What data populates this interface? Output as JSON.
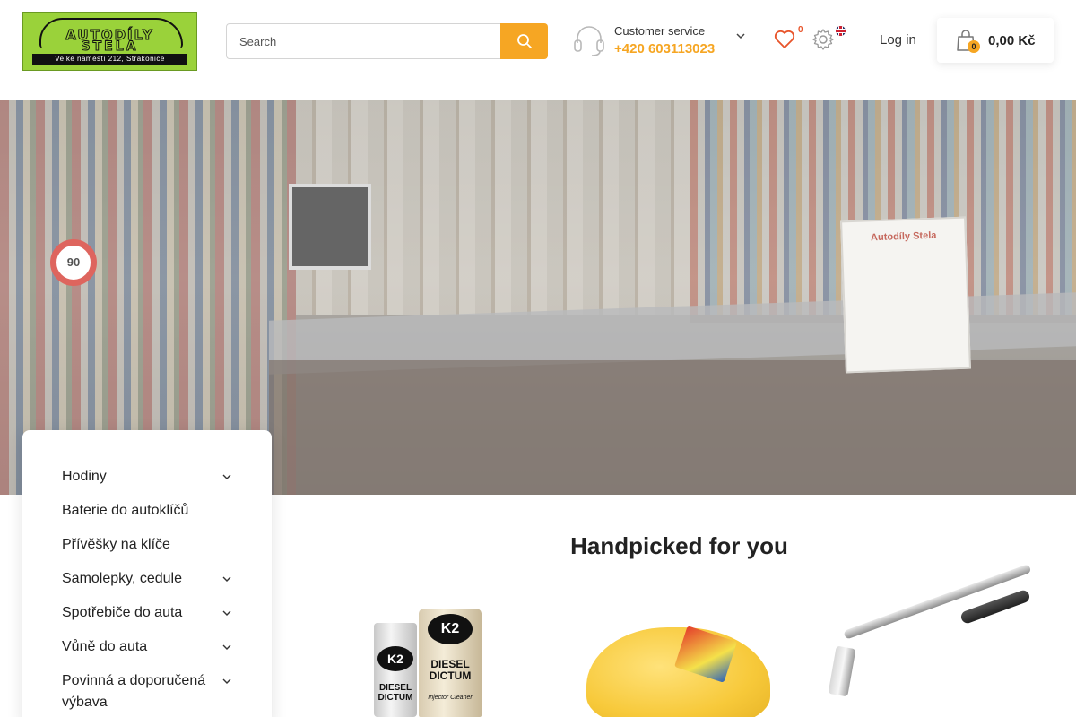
{
  "header": {
    "logo": {
      "line1": "AUTODÍLY",
      "line2": "STELA",
      "address": "Velké náměstí 212, Strakonice"
    },
    "search": {
      "placeholder": "Search"
    },
    "customer_service": {
      "label": "Customer service",
      "phone": "+420 603113023"
    },
    "wishlist_count": "0",
    "login_label": "Log in",
    "cart": {
      "count": "0",
      "total": "0,00 Kč"
    }
  },
  "hero": {
    "sign_text": "Autodíly Stela",
    "speed_sign": "90"
  },
  "sidebar": {
    "items": [
      {
        "label": "Hodiny",
        "has_children": true
      },
      {
        "label": "Baterie do autoklíčů",
        "has_children": false
      },
      {
        "label": "Přívěšky na klíče",
        "has_children": false
      },
      {
        "label": "Samolepky, cedule",
        "has_children": true
      },
      {
        "label": "Spotřebiče do auta",
        "has_children": true
      },
      {
        "label": "Vůně do auta",
        "has_children": true
      },
      {
        "label": "Povinná a doporučená výbava",
        "has_children": true
      }
    ]
  },
  "main": {
    "section_title": "Handpicked for you",
    "products": [
      {
        "brand": "K2",
        "name": "DIESEL DICTUM",
        "sub": "Injector Cleaner"
      },
      {
        "brand": "",
        "name": "",
        "sub": ""
      },
      {
        "brand": "",
        "name": "",
        "sub": ""
      }
    ]
  },
  "colors": {
    "accent": "#f6a623",
    "logo_green": "#9ad23a",
    "wishlist_badge": "#e8542a"
  },
  "icons": {
    "search": "search-icon",
    "customer_service": "headset-icon",
    "dropdown": "chevron-down-icon",
    "wishlist": "heart-icon",
    "settings": "gear-icon",
    "language": "uk-flag-icon",
    "cart": "shopping-bag-icon"
  }
}
